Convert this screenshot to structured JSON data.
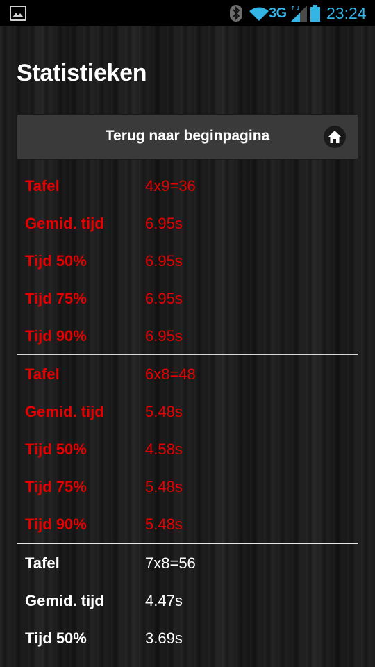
{
  "statusbar": {
    "network": "3G",
    "time": "23:24",
    "left_icon": "image-notification-icon",
    "bluetooth_icon": "bluetooth-icon",
    "wifi_icon": "wifi-icon",
    "signal_icon": "signal-icon",
    "battery_icon": "battery-icon",
    "accent_color": "#33b5e5"
  },
  "page": {
    "title": "Statistieken"
  },
  "home_button": {
    "label": "Terug naar beginpagina",
    "icon": "home-icon"
  },
  "colors": {
    "highlight": "#e60000",
    "normal": "#ffffff"
  },
  "groups": [
    {
      "color": "red",
      "rows": [
        {
          "label": "Tafel",
          "value": "4x9=36"
        },
        {
          "label": "Gemid. tijd",
          "value": "6.95s"
        },
        {
          "label": "Tijd 50%",
          "value": "6.95s"
        },
        {
          "label": "Tijd 75%",
          "value": "6.95s"
        },
        {
          "label": "Tijd 90%",
          "value": "6.95s"
        }
      ]
    },
    {
      "color": "red",
      "rows": [
        {
          "label": "Tafel",
          "value": "6x8=48"
        },
        {
          "label": "Gemid. tijd",
          "value": "5.48s"
        },
        {
          "label": "Tijd 50%",
          "value": "4.58s"
        },
        {
          "label": "Tijd 75%",
          "value": "5.48s"
        },
        {
          "label": "Tijd 90%",
          "value": "5.48s"
        }
      ]
    },
    {
      "color": "white",
      "rows": [
        {
          "label": "Tafel",
          "value": "7x8=56"
        },
        {
          "label": "Gemid. tijd",
          "value": "4.47s"
        },
        {
          "label": "Tijd 50%",
          "value": "3.69s"
        }
      ]
    }
  ]
}
